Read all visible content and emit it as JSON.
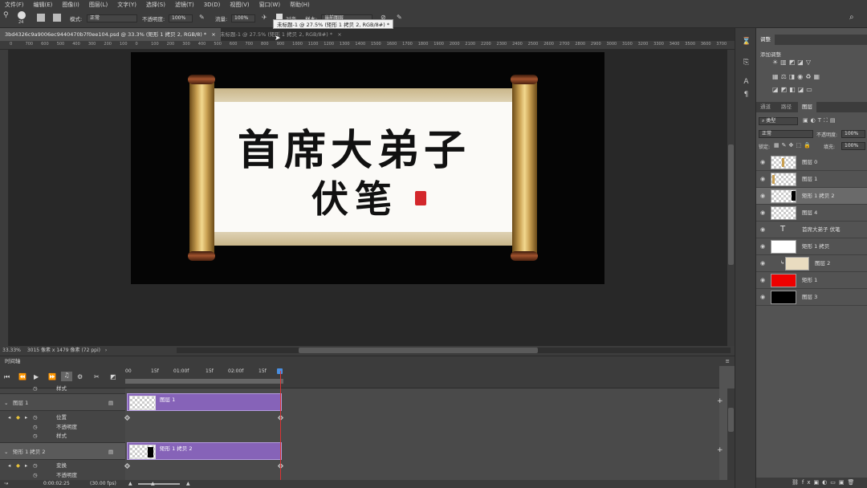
{
  "menubar": [
    "文件(F)",
    "编辑(E)",
    "图像(I)",
    "图层(L)",
    "文字(Y)",
    "选择(S)",
    "滤镜(T)",
    "3D(D)",
    "视图(V)",
    "窗口(W)",
    "帮助(H)"
  ],
  "options": {
    "brush_size": "24",
    "mode_label": "模式:",
    "mode_value": "正常",
    "opacity_label": "不透明度:",
    "opacity_value": "100%",
    "flow_label": "流量:",
    "flow_value": "100%",
    "align_label": "对齐",
    "sample_label": "样本:",
    "sample_value": "当前图层"
  },
  "tabs": [
    {
      "label": "3bd4326c9a9006ec9440470b7f0ee104.psd @ 33.3% (矩形 1 拷贝 2, RGB/8) *"
    },
    {
      "label": "未标题-1 @ 27.5% (矩形 1 拷贝 2, RGB/8#) *"
    }
  ],
  "tooltip": "未标题-1 @ 27.5% (矩形 1 拷贝 2, RGB/8#) *",
  "ruler_ticks": [
    "0",
    "700",
    "600",
    "500",
    "400",
    "300",
    "200",
    "100",
    "0",
    "100",
    "200",
    "300",
    "400",
    "500",
    "600",
    "700",
    "800",
    "900",
    "1000",
    "1100",
    "1200",
    "1300",
    "1400",
    "1500",
    "1600",
    "1700",
    "1800",
    "1900",
    "2000",
    "2100",
    "2200",
    "2300",
    "2400",
    "2500",
    "2600",
    "2700",
    "2800",
    "2900",
    "3000",
    "3100",
    "3200",
    "3300",
    "3400",
    "3500",
    "3600",
    "3700"
  ],
  "canvas": {
    "line1": "首席大弟子",
    "line2": "伏笔"
  },
  "status": {
    "zoom": "33.33%",
    "doc_size": "3015 像素 x 1479 像素 (72 ppi)"
  },
  "timeline": {
    "panel_title": "时间轴",
    "ruler_labels": [
      "00",
      "15f",
      "01:00f",
      "15f",
      "02:00f",
      "15f"
    ],
    "top_row_label": "样式",
    "layers": [
      {
        "name": "图层 1",
        "clip_label": "图层 1",
        "props": [
          "位置",
          "不透明度",
          "样式"
        ]
      },
      {
        "name": "矩形 1 拷贝 2",
        "clip_label": "矩形 1 拷贝 2",
        "props": [
          "变换",
          "不透明度"
        ]
      }
    ],
    "timecode": "0:00:02:25",
    "fps": "(30.00 fps)"
  },
  "panel": {
    "adjust_tab": "调整",
    "add_adjust_label": "添加调整",
    "tabs": [
      "通道",
      "路径",
      "图层"
    ],
    "filter_label": "类型",
    "blend_mode": "正常",
    "opacity_label": "不透明度:",
    "opacity_value": "100%",
    "lock_label": "锁定:",
    "fill_label": "填充:",
    "fill_value": "100%",
    "layers": [
      {
        "name": "图层 0"
      },
      {
        "name": "图层 1"
      },
      {
        "name": "矩形 1 拷贝 2"
      },
      {
        "name": "图层 4"
      },
      {
        "name": "首席大弟子 伏笔"
      },
      {
        "name": "矩形 1 拷贝"
      },
      {
        "name": "图层 2"
      },
      {
        "name": "矩形 1"
      },
      {
        "name": "图层 3"
      }
    ]
  },
  "colors": {
    "clip": "#8663b8",
    "seal": "#d3272b",
    "playhead": "#dd3333"
  }
}
